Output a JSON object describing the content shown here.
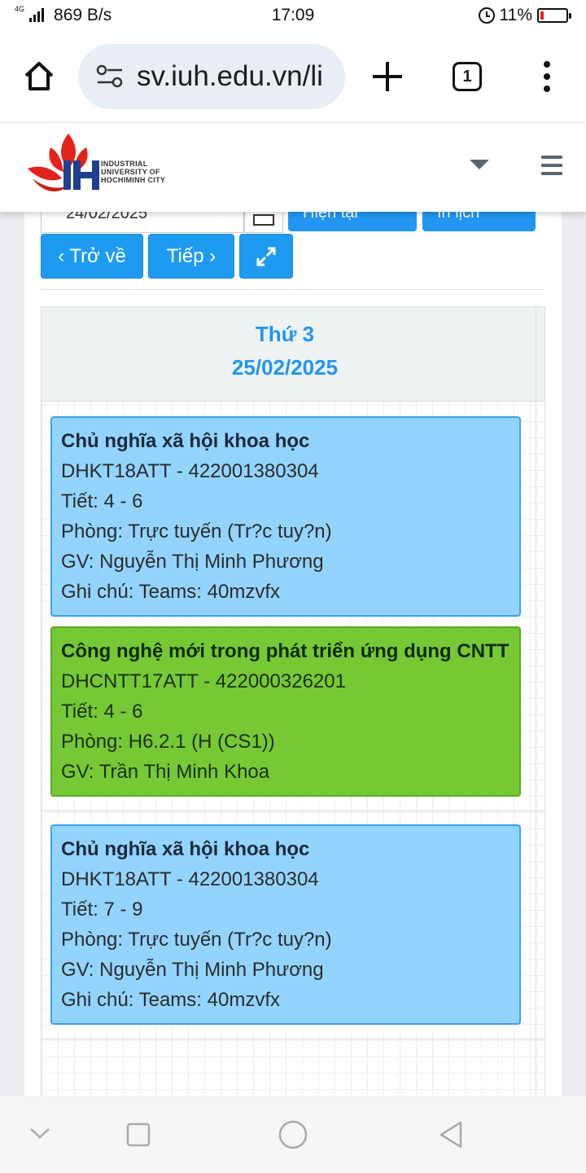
{
  "status_bar": {
    "network": "4G",
    "speed": "869 B/s",
    "time": "17:09",
    "battery": "11%",
    "battery_level": 0.11
  },
  "browser": {
    "url": "sv.iuh.edu.vn/li",
    "tab_count": "1"
  },
  "site": {
    "logo_lines": [
      "INDUSTRIAL",
      "UNIVERSITY OF",
      "HOCHIMINH CITY"
    ]
  },
  "toolbar": {
    "date_value": "24/02/2025",
    "current_label": "Hiện tại",
    "print_label": "In lịch",
    "back_label": "‹ Trở về",
    "next_label": "Tiếp ›"
  },
  "schedule": {
    "day_name": "Thứ 3",
    "date": "25/02/2025",
    "events": [
      {
        "color": "#93d4ff",
        "title": "Chủ nghĩa xã hội khoa học",
        "code": "DHKT18ATT - 422001380304",
        "periods": "Tiết: 4 - 6",
        "room": "Phòng: Trực tuyến (Tr?c tuy?n)",
        "teacher": "GV: Nguyễn Thị Minh Phương",
        "note": "Ghi chú: Teams: 40mzvfx"
      },
      {
        "color": "#76c935",
        "title": "Công nghệ mới trong phát triển ứng dụng CNTT",
        "code": "DHCNTT17ATT - 422000326201",
        "periods": "Tiết: 4 - 6",
        "room": "Phòng: H6.2.1 (H (CS1))",
        "teacher": "GV: Trần Thị Minh Khoa"
      },
      {
        "color": "#93d4ff",
        "title": "Chủ nghĩa xã hội khoa học",
        "code": "DHKT18ATT - 422001380304",
        "periods": "Tiết: 7 - 9",
        "room": "Phòng: Trực tuyến (Tr?c tuy?n)",
        "teacher": "GV: Nguyễn Thị Minh Phương",
        "note": "Ghi chú: Teams: 40mzvfx"
      }
    ]
  },
  "nav_icons": [
    "chevron-down-icon",
    "square-icon",
    "circle-icon",
    "triangle-back-icon"
  ]
}
